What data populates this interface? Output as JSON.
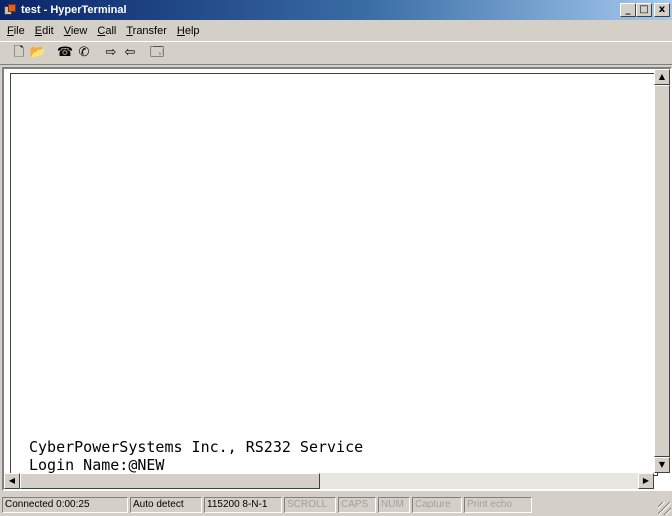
{
  "window": {
    "title": "test - HyperTerminal",
    "minimize": "_",
    "maximize": "□",
    "close": "x"
  },
  "menu": [
    {
      "key": "F",
      "rest": "ile"
    },
    {
      "key": "E",
      "rest": "dit"
    },
    {
      "key": "V",
      "rest": "iew"
    },
    {
      "key": "C",
      "rest": "all"
    },
    {
      "key": "T",
      "rest": "ransfer"
    },
    {
      "key": "H",
      "rest": "elp"
    }
  ],
  "toolbar": {
    "new_icon": "🗋",
    "open_icon": "📂",
    "call_icon": "☎",
    "disconnect_icon": "✆",
    "send_icon": "⇨",
    "receive_icon": "⇦",
    "properties_icon": "🗔"
  },
  "terminal": {
    "line1": "CyberPowerSystems Inc., RS232 Service",
    "line2": "Login Name:@NEW"
  },
  "scrollbar": {
    "up": "▲",
    "down": "▼",
    "left": "◀",
    "right": "▶"
  },
  "status": {
    "connected": "Connected 0:00:25",
    "detect": "Auto detect",
    "settings": "115200 8-N-1",
    "scroll": "SCROLL",
    "caps": "CAPS",
    "num": "NUM",
    "capture": "Capture",
    "print_echo": "Print echo"
  }
}
